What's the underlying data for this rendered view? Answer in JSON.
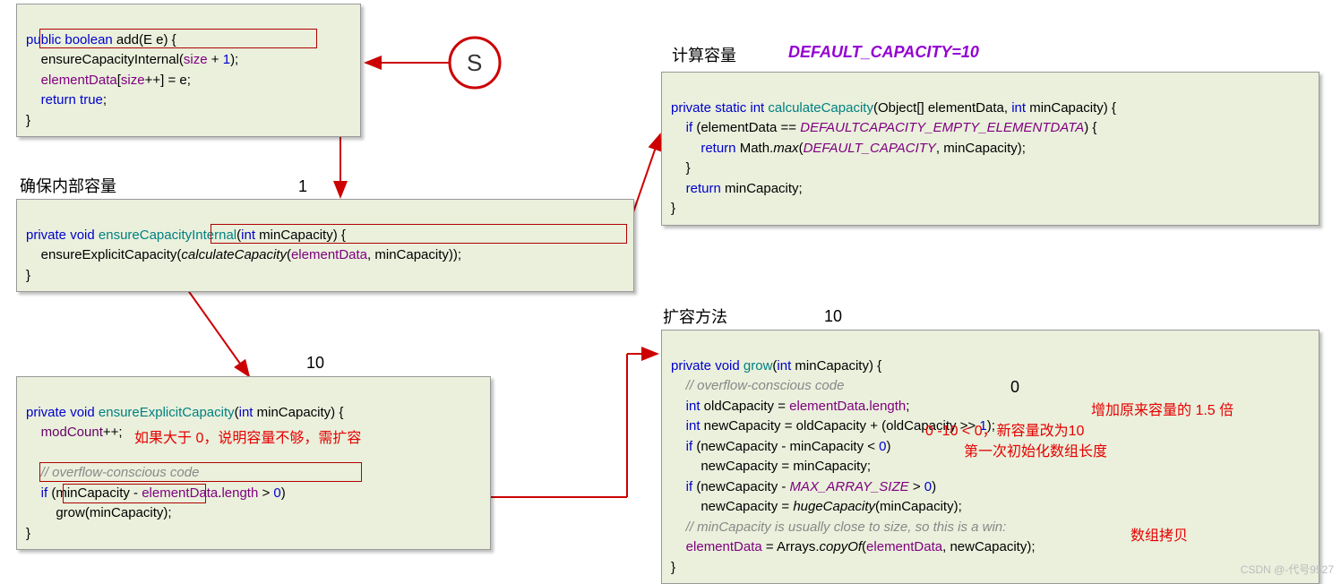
{
  "labels": {
    "ensure_internal_title": "确保内部容量",
    "calc_capacity_title": "计算容量",
    "grow_title": "扩容方法",
    "default_capacity": "DEFAULT_CAPACITY=10"
  },
  "numbers": {
    "above_internal": "1",
    "above_explicit": "10",
    "above_grow": "10",
    "zero_inline": "0"
  },
  "annotations": {
    "explicit_note": "如果大于 0，说明容量不够，需扩容",
    "grow_1_5": "增加原来容量的 1.5 倍",
    "grow_new10": "0 -10 < 0，新容量改为10",
    "grow_firstinit": "第一次初始化数组长度",
    "grow_copy": "数组拷贝"
  },
  "circle_text": "S",
  "watermark": "CSDN @-代号9527",
  "code": {
    "add": {
      "l1a": "public",
      "l1b": " boolean",
      "l1c": " add",
      "l1d": "(E e) {",
      "l2a": "    ensureCapacityInternal(",
      "l2b": "size",
      "l2c": " + ",
      "l2d": "1",
      "l2e": ");",
      "l3a": "    ",
      "l3b": "elementData",
      "l3c": "[",
      "l3d": "size",
      "l3e": "++] = e;",
      "l4a": "    return",
      "l4b": " true",
      "l4c": ";",
      "l5": "}"
    },
    "internal": {
      "l1a": "private",
      "l1b": " void",
      "l1c": " ensureCapacityInternal",
      "l1d": "(",
      "l1e": "int",
      "l1f": " minCapacity) {",
      "l2a": "    ensureExplicitCapacity(",
      "l2b": "calculateCapacity",
      "l2c": "(",
      "l2d": "elementData",
      "l2e": ", minCapacity));",
      "l3": "}"
    },
    "explicit": {
      "l1a": "private",
      "l1b": " void",
      "l1c": " ensureExplicitCapacity",
      "l1d": "(",
      "l1e": "int",
      "l1f": " minCapacity) {",
      "l2a": "    ",
      "l2b": "modCount",
      "l2c": "++;",
      "l3": "",
      "l4": "    // overflow-conscious code",
      "l5a": "    if",
      "l5b": " (minCapacity - ",
      "l5c": "elementData",
      "l5d": ".",
      "l5e": "length",
      "l5f": " > ",
      "l5g": "0",
      "l5h": ")",
      "l6a": "        grow(minCapacity);",
      "l7": "}"
    },
    "calc": {
      "l1a": "private",
      "l1b": " static",
      "l1c": " int",
      "l1d": " calculateCapacity",
      "l1e": "(Object[] elementData, ",
      "l1f": "int",
      "l1g": " minCapacity) {",
      "l2a": "    if",
      "l2b": " (elementData == ",
      "l2c": "DEFAULTCAPACITY_EMPTY_ELEMENTDATA",
      "l2d": ") {",
      "l3a": "        return",
      "l3b": " Math.",
      "l3c": "max",
      "l3d": "(",
      "l3e": "DEFAULT_CAPACITY",
      "l3f": ", minCapacity);",
      "l4": "    }",
      "l5a": "    return",
      "l5b": " minCapacity;",
      "l6": "}"
    },
    "grow": {
      "l1a": "private",
      "l1b": " void",
      "l1c": " grow",
      "l1d": "(",
      "l1e": "int",
      "l1f": " minCapacity) {",
      "l2": "    // overflow-conscious code",
      "l3a": "    int",
      "l3b": " oldCapacity = ",
      "l3c": "elementData",
      "l3d": ".",
      "l3e": "length",
      "l3f": ";",
      "l4a": "    int",
      "l4b": " newCapacity = oldCapacity + (oldCapacity >> ",
      "l4c": "1",
      "l4d": ");",
      "l5a": "    if",
      "l5b": " (newCapacity - minCapacity < ",
      "l5c": "0",
      "l5d": ")",
      "l6": "        newCapacity = minCapacity;",
      "l7a": "    if",
      "l7b": " (newCapacity - ",
      "l7c": "MAX_ARRAY_SIZE",
      "l7d": " > ",
      "l7e": "0",
      "l7f": ")",
      "l8a": "        newCapacity = ",
      "l8b": "hugeCapacity",
      "l8c": "(minCapacity);",
      "l9": "    // minCapacity is usually close to size, so this is a win:",
      "l10a": "    ",
      "l10b": "elementData",
      "l10c": " = Arrays.",
      "l10d": "copyOf",
      "l10e": "(",
      "l10f": "elementData",
      "l10g": ", newCapacity);",
      "l11": "}"
    }
  }
}
